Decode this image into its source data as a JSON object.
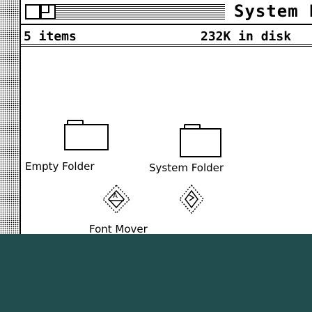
{
  "window": {
    "title": "System Dis",
    "items_count": "5 items",
    "disk_free": "232K in disk"
  },
  "icons": [
    {
      "label": "Empty Folder",
      "icon": "folder-icon"
    },
    {
      "label": "System Folder",
      "icon": "folder-icon"
    },
    {
      "label": "Font Mover",
      "icon": "font-mover-icon"
    },
    {
      "label": "",
      "icon": "diamond-app-icon"
    }
  ],
  "colors": {
    "bottom_bar": "#224d4e",
    "window_bg": "#ffffff",
    "ink": "#000000"
  }
}
